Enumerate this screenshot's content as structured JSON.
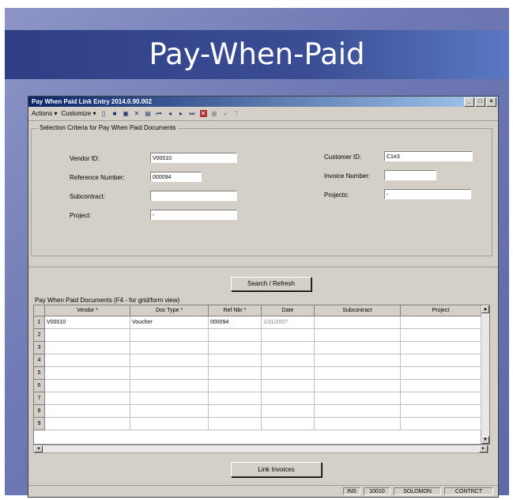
{
  "slide": {
    "title": "Pay-When-Paid"
  },
  "window": {
    "title": "Pay When Paid Link Entry  2014.0.90.002",
    "controls": [
      "_",
      "□",
      "×"
    ]
  },
  "toolbar": {
    "actions_label": "Actions ▾",
    "customize_label": "Customize ▾"
  },
  "criteria": {
    "legend": "Selection Criteria for Pay When Paid Documents",
    "vendor_id_label": "Vendor ID:",
    "vendor_id_value": "V00010",
    "reference_number_label": "Reference Number:",
    "reference_number_value": "000094",
    "subcontract_label": "Subcontract:",
    "subcontract_value": "",
    "project_label": "Project:",
    "project_value": "-",
    "customer_id_label": "Customer ID:",
    "customer_id_value": "C1e3",
    "invoice_number_label": "Invoice Number:",
    "invoice_number_value": "",
    "projects_label": "Projects:",
    "projects_value": "-"
  },
  "search_button": "Search / Refresh",
  "grid": {
    "legend": "Pay When Paid Documents (F4 - for grid/form view)",
    "columns": [
      "Vendor *",
      "Doc Type *",
      "Ref Nbr *",
      "Date",
      "Subcontract",
      "Project"
    ],
    "rows": [
      {
        "num": "1",
        "cells": [
          "V00010",
          "Voucher",
          "000094",
          "1/31/2007",
          "",
          ""
        ]
      },
      {
        "num": "2",
        "cells": [
          "",
          "",
          "",
          "",
          "",
          ""
        ]
      },
      {
        "num": "3",
        "cells": [
          "",
          "",
          "",
          "",
          "",
          ""
        ]
      },
      {
        "num": "4",
        "cells": [
          "",
          "",
          "",
          "",
          "",
          ""
        ]
      },
      {
        "num": "5",
        "cells": [
          "",
          "",
          "",
          "",
          "",
          ""
        ]
      },
      {
        "num": "6",
        "cells": [
          "",
          "",
          "",
          "",
          "",
          ""
        ]
      },
      {
        "num": "7",
        "cells": [
          "",
          "",
          "",
          "",
          "",
          ""
        ]
      },
      {
        "num": "8",
        "cells": [
          "",
          "",
          "",
          "",
          "",
          ""
        ]
      },
      {
        "num": "9",
        "cells": [
          "",
          "",
          "",
          "",
          "",
          ""
        ]
      }
    ]
  },
  "link_button": "Link Invoices",
  "status": [
    "INS",
    "10010",
    "SOLOMON",
    "CONTRCT"
  ]
}
